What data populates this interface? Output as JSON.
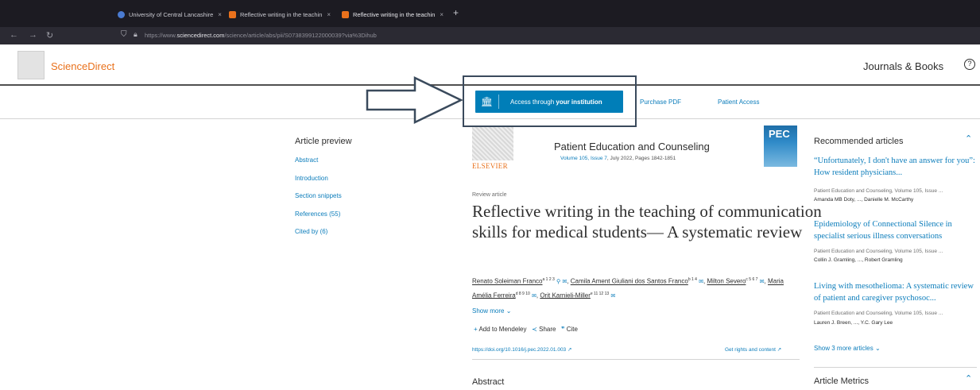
{
  "browser": {
    "tabs": [
      {
        "label": "University of Central Lancashire",
        "favicon_color": "#4a7bd1"
      },
      {
        "label": "Reflective writing in the teachin",
        "favicon_color": "#e9711c"
      },
      {
        "label": "Reflective writing in the teachin",
        "favicon_color": "#e9711c"
      }
    ],
    "new_tab": "+",
    "close_glyph": "×",
    "url_prefix": "https://www.",
    "url_domain": "sciencedirect.com",
    "url_path": "/science/article/abs/pii/S0738399122000039?via%3Dihub"
  },
  "header": {
    "brand": "ScienceDirect",
    "journals_books": "Journals & Books",
    "help": "?"
  },
  "access": {
    "access_through": "Access through ",
    "your_institution": "your institution",
    "purchase_pdf": "Purchase PDF",
    "patient_access": "Patient Access"
  },
  "preview": {
    "title": "Article preview",
    "links": [
      "Abstract",
      "Introduction",
      "Section snippets",
      "References (55)",
      "Cited by (6)"
    ]
  },
  "article": {
    "publisher": "ELSEVIER",
    "journal": "Patient Education and Counseling",
    "volume_link": "Volume 105, Issue 7",
    "volume_rest": ", July 2022, Pages 1842-1851",
    "cover_label": "PEC",
    "type": "Review article",
    "title": "Reflective writing in the teaching of communication skills for medical students— A systematic review",
    "authors": [
      {
        "name": "Renato Soleiman Franco",
        "sup": "a 1 2 3"
      },
      {
        "name": "Camila Ament Giuliani dos Santos Franco",
        "sup": "b 1 4"
      },
      {
        "name": "Milton Severo",
        "sup": "c 5 6 7"
      },
      {
        "name": "Maria Amélia Ferreira",
        "sup": "d 8 9 10"
      },
      {
        "name": "Orit Karnieli-Miller",
        "sup": "e 11 12 13"
      }
    ],
    "show_more": "Show more",
    "add_mendeley": "Add to Mendeley",
    "share": "Share",
    "cite": "Cite",
    "doi": "https://doi.org/10.1016/j.pec.2022.01.003",
    "rights": "Get rights and content",
    "abstract_heading": "Abstract"
  },
  "recommended": {
    "title": "Recommended articles",
    "items": [
      {
        "title": "“Unfortunately, I don't have an answer for you”: How resident physicians...",
        "source": "Patient Education and Counseling, Volume 105, Issue ...",
        "authors": "Amanda MB Doty, ..., Danielle M. McCarthy"
      },
      {
        "title": "Epidemiology of Connectional Silence in specialist serious illness conversations",
        "source": "Patient Education and Counseling, Volume 105, Issue ...",
        "authors": "Collin J. Gramling, ..., Robert Gramling"
      },
      {
        "title": "Living with mesothelioma: A systematic review of patient and caregiver psychosoc...",
        "source": "Patient Education and Counseling, Volume 105, Issue ...",
        "authors": "Lauren J. Breen, ..., Y.C. Gary Lee"
      }
    ],
    "show_more": "Show 3 more articles",
    "metrics_title": "Article Metrics"
  }
}
